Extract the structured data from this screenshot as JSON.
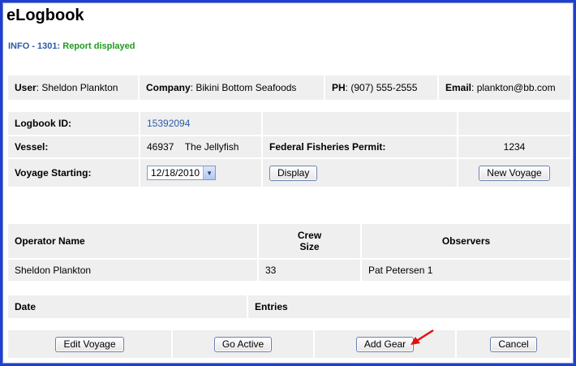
{
  "app": {
    "title": "eLogbook"
  },
  "info": {
    "code": "INFO - 1301:",
    "message": "Report displayed"
  },
  "user_bar": {
    "user_label": "User",
    "user_value": "Sheldon Plankton",
    "company_label": "Company",
    "company_value": "Bikini Bottom Seafoods",
    "phone_label": "PH",
    "phone_value": "(907) 555-2555",
    "email_label": "Email",
    "email_value": "plankton@bb.com"
  },
  "logbook": {
    "id_label": "Logbook ID:",
    "id_value": "15392094",
    "vessel_label": "Vessel:",
    "vessel_number": "46937",
    "vessel_name": "The Jellyfish",
    "permit_label": "Federal Fisheries Permit:",
    "permit_value": "1234",
    "voyage_label": "Voyage Starting:",
    "voyage_date": "12/18/2010",
    "display_button": "Display",
    "new_voyage_button": "New Voyage"
  },
  "crew_table": {
    "headers": {
      "operator": "Operator Name",
      "crew_line1": "Crew",
      "crew_line2": "Size",
      "observers": "Observers"
    },
    "row": {
      "operator": "Sheldon Plankton",
      "crew": "33",
      "observers": "Pat Petersen 1"
    }
  },
  "entries_table": {
    "headers": {
      "date": "Date",
      "entries": "Entries"
    }
  },
  "actions": {
    "edit_voyage": "Edit Voyage",
    "go_active": "Go Active",
    "add_gear": "Add Gear",
    "cancel": "Cancel"
  },
  "colors": {
    "frame": "#1f3fd1",
    "cell_bg": "#efefef",
    "info_code": "#2b5aa8",
    "info_text": "#1f9a1f",
    "arrow": "#e01010"
  }
}
